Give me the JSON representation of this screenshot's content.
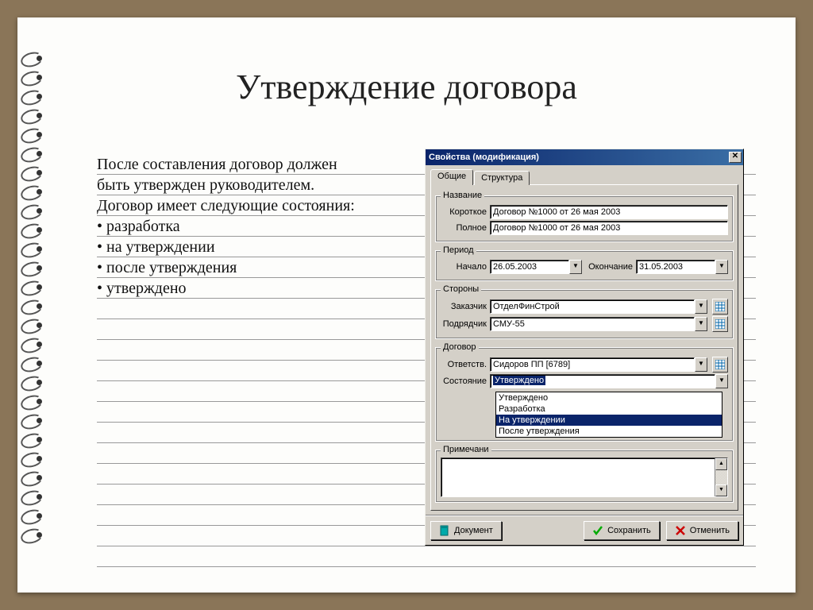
{
  "slide": {
    "title": "Утверждение договора",
    "paragraph": "После составления договор должен\nбыть утвержден руководителем.\nДоговор имеет следующие состояния:",
    "bullets": [
      "разработка",
      "на утверждении",
      "после утверждения",
      "утверждено"
    ]
  },
  "dialog": {
    "title": "Свойства (модификация)",
    "tabs": {
      "general": "Общие",
      "structure": "Структура"
    },
    "groups": {
      "name": {
        "legend": "Название",
        "short_label": "Короткое",
        "short_value": "Договор №1000 от 26 мая 2003",
        "full_label": "Полное",
        "full_value": "Договор №1000 от 26 мая 2003"
      },
      "period": {
        "legend": "Период",
        "start_label": "Начало",
        "start_value": "26.05.2003",
        "end_label": "Окончание",
        "end_value": "31.05.2003"
      },
      "parties": {
        "legend": "Стороны",
        "customer_label": "Заказчик",
        "customer_value": "ОтделФинСтрой",
        "contractor_label": "Подрядчик",
        "contractor_value": "СМУ-55"
      },
      "contract": {
        "legend": "Договор",
        "responsible_label": "Ответств.",
        "responsible_value": "Сидоров ПП [6789]",
        "state_label": "Состояние",
        "state_value": "Утверждено",
        "state_options": [
          "Утверждено",
          "Разработка",
          "На утверждении",
          "После утверждения"
        ],
        "state_highlighted_index": 2
      },
      "note": {
        "legend": "Примечани"
      }
    },
    "buttons": {
      "document": "Документ",
      "save": "Сохранить",
      "cancel": "Отменить"
    }
  }
}
